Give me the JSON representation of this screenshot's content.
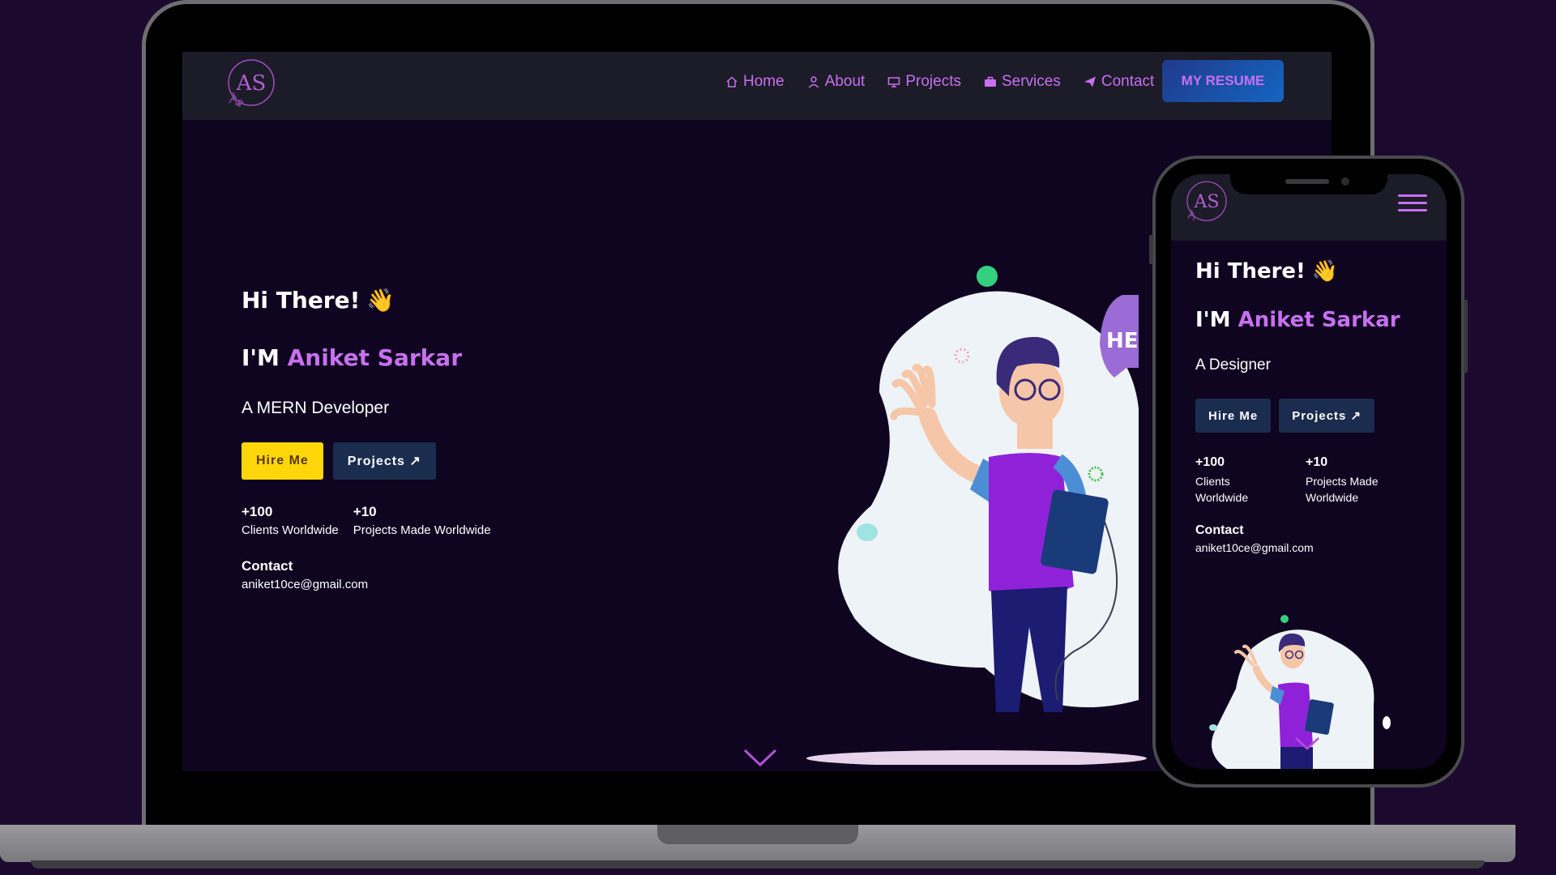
{
  "nav": {
    "items": [
      {
        "label": "Home",
        "icon": "home-icon"
      },
      {
        "label": "About",
        "icon": "user-icon"
      },
      {
        "label": "Projects",
        "icon": "projects-icon"
      },
      {
        "label": "Services",
        "icon": "briefcase-icon"
      },
      {
        "label": "Contact",
        "icon": "send-icon"
      }
    ],
    "resume_label": "MY RESUME",
    "logo_text": "AS"
  },
  "hero": {
    "greeting": "Hi There!",
    "wave_emoji": "👋",
    "im": "I'M",
    "name": "Aniket Sarkar",
    "role": "A MERN Developer",
    "hire_label": "Hire Me",
    "projects_label": "Projects ↗",
    "stats": [
      {
        "num": "+100",
        "label": "Clients Worldwide"
      },
      {
        "num": "+10",
        "label": "Projects Made Worldwide"
      }
    ],
    "contact_label": "Contact",
    "contact_email": "aniket10ce@gmail.com"
  },
  "mobile": {
    "greeting": "Hi There!",
    "im": "I'M",
    "name": "Aniket Sarkar",
    "role": "A Designer",
    "hire_label": "Hire Me",
    "projects_label": "Projects ↗",
    "stats": [
      {
        "num": "+100",
        "label": "Clients Worldwide"
      },
      {
        "num": "+10",
        "label": "Projects Made Worldwide"
      }
    ],
    "contact_label": "Contact",
    "contact_email": "aniket10ce@gmail.com"
  },
  "colors": {
    "accent": "#c770f0",
    "background": "#0f0520",
    "navbar": "#1c1b28",
    "hire_button": "#ffd60a",
    "dark_button": "#1b2d4f"
  }
}
